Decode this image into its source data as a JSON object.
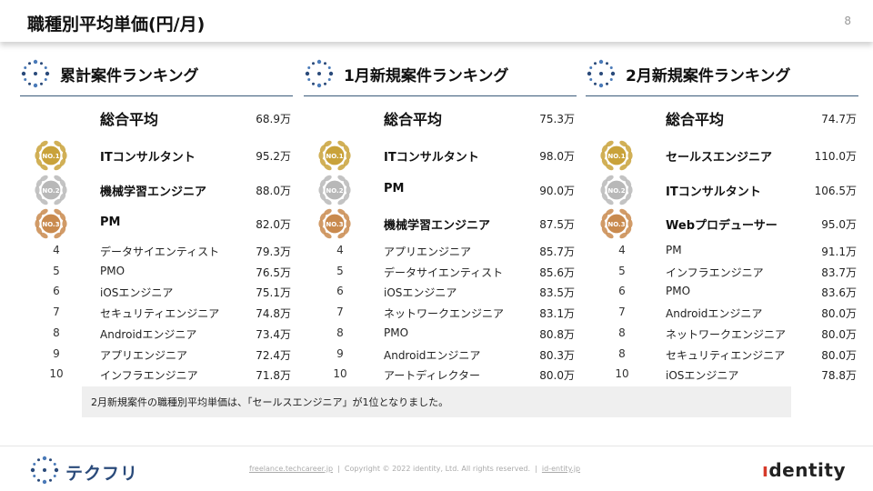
{
  "header": {
    "title": "職種別平均単価(円/月)",
    "page_number": "8"
  },
  "colors": {
    "accent_blue": "#2a4a7a",
    "gold": "#c9a23a",
    "silver": "#b8b8b8",
    "bronze": "#c98a4e"
  },
  "columns": [
    {
      "title": "累計案件ランキング",
      "average": {
        "label": "総合平均",
        "value": "68.9万"
      },
      "top3": [
        {
          "medal": "NO.1",
          "name": "ITコンサルタント",
          "value": "95.2万"
        },
        {
          "medal": "NO.2",
          "name": "機械学習エンジニア",
          "value": "88.0万"
        },
        {
          "medal": "NO.3",
          "name": "PM",
          "value": "82.0万"
        }
      ],
      "rest": [
        {
          "rank": "4",
          "name": "データサイエンティスト",
          "value": "79.3万"
        },
        {
          "rank": "5",
          "name": "PMO",
          "value": "76.5万"
        },
        {
          "rank": "6",
          "name": "iOSエンジニア",
          "value": "75.1万"
        },
        {
          "rank": "7",
          "name": "セキュリティエンジニア",
          "value": "74.8万"
        },
        {
          "rank": "8",
          "name": "Androidエンジニア",
          "value": "73.4万"
        },
        {
          "rank": "9",
          "name": "アプリエンジニア",
          "value": "72.4万"
        },
        {
          "rank": "10",
          "name": "インフラエンジニア",
          "value": "71.8万"
        }
      ]
    },
    {
      "title": "1月新規案件ランキング",
      "average": {
        "label": "総合平均",
        "value": "75.3万"
      },
      "top3": [
        {
          "medal": "NO.1",
          "name": "ITコンサルタント",
          "value": "98.0万"
        },
        {
          "medal": "NO.2",
          "name": "PM",
          "value": "90.0万"
        },
        {
          "medal": "NO.3",
          "name": "機械学習エンジニア",
          "value": "87.5万"
        }
      ],
      "rest": [
        {
          "rank": "4",
          "name": "アプリエンジニア",
          "value": "85.7万"
        },
        {
          "rank": "5",
          "name": "データサイエンティスト",
          "value": "85.6万"
        },
        {
          "rank": "6",
          "name": "iOSエンジニア",
          "value": "83.5万"
        },
        {
          "rank": "7",
          "name": "ネットワークエンジニア",
          "value": "83.1万"
        },
        {
          "rank": "8",
          "name": "PMO",
          "value": "80.8万"
        },
        {
          "rank": "9",
          "name": "Androidエンジニア",
          "value": "80.3万"
        },
        {
          "rank": "10",
          "name": "アートディレクター",
          "value": "80.0万"
        }
      ]
    },
    {
      "title": "2月新規案件ランキング",
      "average": {
        "label": "総合平均",
        "value": "74.7万"
      },
      "top3": [
        {
          "medal": "NO.1",
          "name": "セールスエンジニア",
          "value": "110.0万"
        },
        {
          "medal": "NO.2",
          "name": "ITコンサルタント",
          "value": "106.5万"
        },
        {
          "medal": "NO.3",
          "name": "Webプロデューサー",
          "value": "95.0万"
        }
      ],
      "rest": [
        {
          "rank": "4",
          "name": "PM",
          "value": "91.1万"
        },
        {
          "rank": "5",
          "name": "インフラエンジニア",
          "value": "83.7万"
        },
        {
          "rank": "6",
          "name": "PMO",
          "value": "83.6万"
        },
        {
          "rank": "7",
          "name": "Androidエンジニア",
          "value": "80.0万"
        },
        {
          "rank": "8",
          "name": "ネットワークエンジニア",
          "value": "80.0万"
        },
        {
          "rank": "8",
          "name": "セキュリティエンジニア",
          "value": "80.0万"
        },
        {
          "rank": "10",
          "name": "iOSエンジニア",
          "value": "78.8万"
        }
      ]
    }
  ],
  "note": "2月新規案件の職種別平均単価は、「セールスエンジニア」が1位となりました。",
  "footer": {
    "brand": "テクフリ",
    "link1": "freelance.techcareer.jp",
    "copyright": "Copyright © 2022 identity, Ltd. All rights reserved.",
    "link2": "id-entity.jp",
    "separator": "|",
    "company_a": "ı",
    "company_b": "dentity"
  }
}
